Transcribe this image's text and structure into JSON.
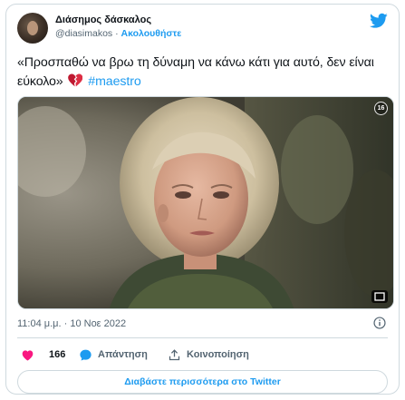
{
  "author": {
    "display_name": "Διάσημος δάσκαλος",
    "handle": "@diasimakos",
    "separator": " · ",
    "follow_label": "Ακολουθήστε"
  },
  "tweet": {
    "text_main": "«Προσπαθώ να βρω τη δύναμη να κάνω κάτι για αυτό, δεν είναι εύκολο»",
    "hashtag": "#maestro",
    "emoji": "broken-heart-icon"
  },
  "media": {
    "age_rating": "16",
    "description_icon": "fullscreen-icon"
  },
  "meta": {
    "timestamp": "11:04 μ.μ. · 10 Νοε 2022"
  },
  "actions": {
    "like_count": "166",
    "reply_label": "Απάντηση",
    "share_label": "Κοινοποίηση"
  },
  "read_more_label": "Διαβάστε περισσότερα στο Twitter",
  "colors": {
    "accent": "#1d9bf0",
    "like": "#f91880",
    "text": "#0f1419",
    "muted": "#536471",
    "border": "#cfd9de"
  }
}
